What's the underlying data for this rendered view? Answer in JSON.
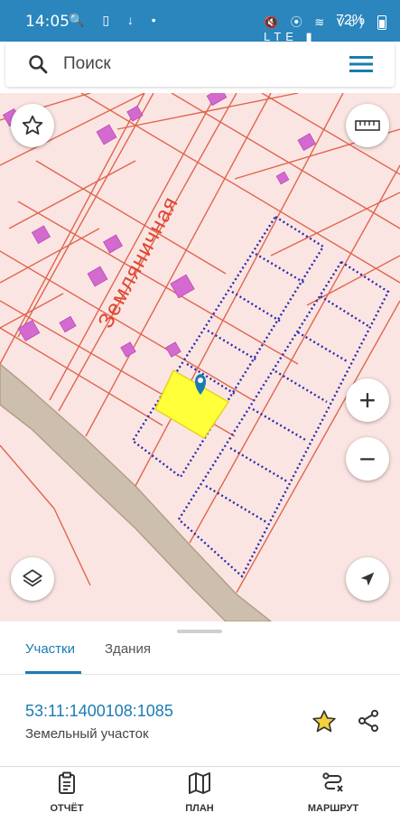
{
  "status_bar": {
    "time": "14:05",
    "left_icons": "🔍 ▯ ↓ •",
    "right_icons": "🔇 ⦿ ≋ Vo) LTE ▮",
    "battery": "72%"
  },
  "search": {
    "placeholder": "Поиск"
  },
  "map": {
    "street_label": "Земляничная",
    "colors": {
      "background": "#fbe5e2",
      "parcel_line": "#e0654e",
      "building_fill": "#d46ad0",
      "planned_line": "#2a2ab0",
      "selected_parcel": "#ffff3a",
      "road": "#cdbfad",
      "accent": "#1a7bb3"
    }
  },
  "map_controls": {
    "favorite": "star-outline-icon",
    "ruler": "ruler-icon",
    "zoom_in": "+",
    "zoom_out": "−",
    "layers": "layers-icon",
    "locate": "navigation-arrow-icon"
  },
  "sheet": {
    "tabs": [
      {
        "label": "Участки",
        "active": true
      },
      {
        "label": "Здания",
        "active": false
      }
    ],
    "cadastral_number": "53:11:1400108:1085",
    "parcel_type": "Земельный участок"
  },
  "bottom_nav": [
    {
      "label": "ОТЧЁТ",
      "icon": "report-icon"
    },
    {
      "label": "ПЛАН",
      "icon": "map-plan-icon"
    },
    {
      "label": "МАРШРУТ",
      "icon": "route-icon"
    }
  ]
}
